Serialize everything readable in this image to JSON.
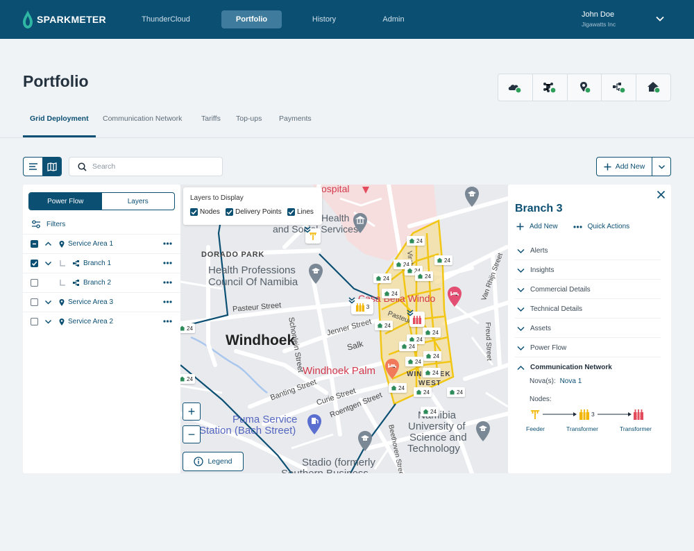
{
  "brand": {
    "name": "SPARKMETER"
  },
  "nav": {
    "items": [
      "ThunderCloud",
      "Portfolio",
      "History",
      "Admin"
    ],
    "active": "Portfolio"
  },
  "user": {
    "name": "John Doe",
    "company": "Jigawatts Inc"
  },
  "page": {
    "title": "Portfolio"
  },
  "quick_icons": [
    "cloud-icon",
    "network-icon",
    "location-icon",
    "branch-icon",
    "home-icon"
  ],
  "status_color": "#2e9e5b",
  "tabs": [
    "Grid Deployment",
    "Communication Network",
    "Tariffs",
    "Top-ups",
    "Payments"
  ],
  "search": {
    "placeholder": "Search"
  },
  "add_new": {
    "label": "Add New"
  },
  "left_panel": {
    "segments": [
      "Power Flow",
      "Layers"
    ],
    "filters_label": "Filters",
    "tree": [
      {
        "label": "Service Area 1",
        "checked": "partial",
        "expanded": true
      },
      {
        "label": "Branch 1",
        "checked": true,
        "expanded": false
      },
      {
        "label": "Branch 2",
        "checked": false
      },
      {
        "label": "Service Area 3",
        "checked": false,
        "expanded": false
      },
      {
        "label": "Service Area 2",
        "checked": false,
        "expanded": false
      }
    ]
  },
  "map": {
    "layers_title": "Layers to Display",
    "layers": [
      "Nodes",
      "Delivery Points",
      "Lines"
    ],
    "zoom_in": "+",
    "zoom_out": "−",
    "legend_label": "Legend",
    "marker_count": "24",
    "transformer_count": "3",
    "places": {
      "hospital": "ospital",
      "health_social_1": "Health",
      "health_social_2": "and Social Services",
      "dorado": "DORADO PARK",
      "hpcn_1": "Health Professions",
      "hpcn_2": "Council Of Namibia",
      "pasteur": "Pasteur Street",
      "schonlein": "Schonlein Street",
      "jenner": "Jenner Street",
      "salk": "Salk",
      "windhoek": "Windhoek",
      "palm": "Windhoek Palm",
      "casa": "Casa Bella Windo",
      "banting": "Banting Street",
      "curie": "Curie Street",
      "roentgen": "Roentgen Street",
      "puma_1": "Puma Service",
      "puma_2": "Station (Bach Street)",
      "nust_1": "Namibia",
      "nust_2": "University of",
      "nust_3": "Science and",
      "nust_4": "Technology",
      "stadio_1": "Stadio (formerly",
      "stadio_2": "Southern Business",
      "wwest_1": "WINDHOEK",
      "wwest_2": "WEST",
      "vanrhijn": "Van Rhijn Street",
      "freud": "Freud Street",
      "beethoven": "Beethoven Street",
      "pasteur2": "Pasteur",
      "virchow": "Virchow"
    }
  },
  "detail": {
    "title": "Branch 3",
    "actions": [
      "Add New",
      "Quick Actions"
    ],
    "sections": [
      "Alerts",
      "Insights",
      "Commercial Details",
      "Technical Details",
      "Assets",
      "Power Flow",
      "Communication Network"
    ],
    "expanded_section": "Communication Network",
    "nova_label": "Nova(s):",
    "nova_value": "Nova 1",
    "nodes_label": "Nodes:",
    "nodes": [
      {
        "type": "Feeder"
      },
      {
        "type": "Transformer",
        "count": "3"
      },
      {
        "type": "Transformer"
      }
    ]
  }
}
